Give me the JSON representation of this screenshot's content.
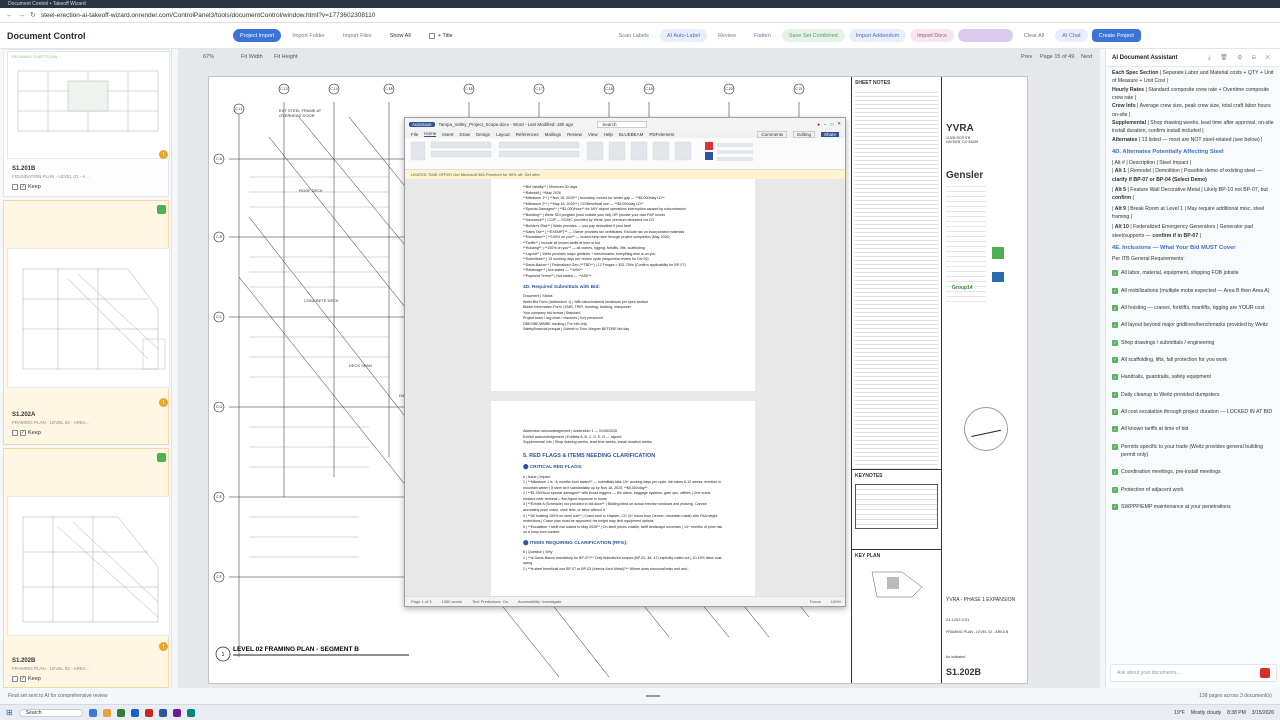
{
  "browser": {
    "tab_title": "Document Control • Takeoff Wizard",
    "url": "steel-erection-ai-takeoff-wizard.onrender.com/ControlPanel3/tools/documentControl/window.html?v=1773602308110"
  },
  "header": {
    "title": "Document Control",
    "buttons": [
      "Project Import",
      "Import Folder",
      "Import Files",
      "Show All",
      "+ Title",
      "Scan Labels",
      "AI Auto-Label",
      "Review",
      "Flatten",
      "Save Set Combined",
      "Import Addendum",
      "Import Docs",
      "",
      "Clear All",
      "AI Chat",
      "Create Project"
    ]
  },
  "sheets": [
    {
      "id": "S1.201B",
      "desc": "FOUNDATION PLAN - LEVEL 01 - A...",
      "keep": "Keep",
      "badge": "",
      "top_label": "RETAINED SHEETS (59)"
    },
    {
      "id": "S1.202A",
      "desc": "FRAMING PLAN - LEVEL 02 - AREA...",
      "keep": "Keep",
      "badge": "5"
    },
    {
      "id": "S1.202B",
      "desc": "FRAMING PLAN - LEVEL 02 - AREA...",
      "keep": "Keep",
      "badge": "5"
    }
  ],
  "viewer": {
    "zoom": "67%",
    "fit_width": "Fit Width",
    "fit_height": "Fit Height",
    "prev": "Prev",
    "page_info": "Page 15 of 49",
    "next": "Next",
    "plan_title": "LEVEL 02 FRAMING PLAN - SEGMENT B",
    "plan_number": "1",
    "grid_labels": [
      "C.11",
      "C.13",
      "C.14",
      "C.15",
      "C.16",
      "C.17",
      "C.18",
      "C.19",
      "C.20",
      "C.21",
      "C.A",
      "C.B",
      "C.C",
      "C.D",
      "C.E",
      "C.F"
    ]
  },
  "titleblock": {
    "sheet_notes": "SHEET NOTES",
    "keynotes": "KEYNOTES",
    "key_plan": "KEY PLAN",
    "client": "YVRA",
    "client_addr": "11305 RCR S'B\nHAYDEN, CO 81639",
    "architect": "Gensler",
    "group": "Group14",
    "project": "YVRA - PHASE 1 EXPANSION",
    "project_no": "24.1202.0.01",
    "sheet_title": "FRAMING PLAN - LEVEL 02 - AREA B",
    "sheet_no": "S1.202B",
    "scale": "As indicated"
  },
  "word": {
    "title": "Tampa_Valley_Project_Scope.docx  -  Word  -  Last Modified: 19h ago",
    "search": "Search",
    "menus": [
      "File",
      "Home",
      "Insert",
      "Draw",
      "Design",
      "Layout",
      "References",
      "Mailings",
      "Review",
      "View",
      "Help",
      "BLUEBEAM",
      "PDFelement"
    ],
    "comments": "Comments",
    "editing": "Editing",
    "share": "Share",
    "notice": "LIMITED TIME OFFER   Get Microsoft 365 Premium for 50% off.    Get offer",
    "page1_lines": [
      "**Bid Validity**  |  Minimum 30 days",
      "**Rate###  |  **May 2026",
      "**Milestone 1**  |  **Nov 18, 2025**  |  boundary, moved for winter gap — **$5,000/day LD**",
      "**Milestone 2**  |  **May 16, 2026**  |  CO/Beneficial use — **$3,000/day LD**",
      "**Special Damages**  |  **$1,000/hour** for ANY airport operations interruption caused by subcontractor",
      "**Bonding**  |  Weitz SDI program (cost outside your bid) OR provide your own P&P bonds",
      "**Insurance**  |  CCIP — SC/MC provided by Weitz; your premium deducted via CO",
      "**Builder's Risk**  |  Weitz provides — you pay deductible if your fault",
      "**Sales Tax**  |  **EXEMPT** — Owner provides tax certificates. Exclude tax on incorporated materials",
      "**Escalation**  |  **100% on you** — locked lump sum through project completion (May 2026)",
      "**Tariffs**  |  Include all known tariffs at time of bid",
      "**Hoisting**  |  **100% on you** — all cranes, rigging, forklifts, lifts, scaffolding",
      "**Layout**  |  Weitz provides major gridlines + benchmarks; everything else is on you",
      "**Submittals**  |  15 working days per review cycle (sequential review for Div 05)",
      "**Davis-Bacon**  |  Federalized Gen (**TBD**) | 12 Fringes = $31.75/hr (Confirm applicability for BP-07)",
      "**Retainage**  |  Not stated — **ASK**",
      "**Payment Terms**  |  Not stated — **ASK**"
    ],
    "section_4d": "4D. Required Submittals with Bid:",
    "page1_tail": [
      "Document  |  Status",
      "Weitz Bid Form (Addendum 1)  |  With labor/material breakouts per spec section",
      "Bidder Information Form  |  EMR, TRIR, bonding, backlog, manpower",
      "Your company bid format  |  Standard",
      "Project team / org chart / resumes  |  Key personnel",
      "DBE/SBE/WMBE tracking  |  For info only",
      "Safety/financial prequal  |  Submit to Trico Wegner BEFORE bid day"
    ],
    "page2_lines": [
      "Addendum acknowledgement  |  Addendum 1 — 01/06/2026",
      "Exhibit acknowledgement  |  Exhibits A, B, C, D, E, G — signed",
      "Supplemental info  |  Shop drawing weeks, lead time weeks, install duration weeks"
    ],
    "section_5": "5. RED FLAGS & ITEMS NEEDING CLARIFICATION",
    "critical": "CRITICAL RED FLAGS:",
    "critical_lines": [
      "#  |  Issue  |  Impact",
      "1  |  **Milestone 1 is ~6 months from award** — submittals take 15+ working days per cycle, fab takes 8-12 weeks; erection in mountain winter  |  If steel isn't substantially up by Nov 18, 2025, **$5,000/day**",
      "2  |  **$1,000/hour special damages** with broad triggers — fire alarm, baggage systems, gate ops, utilities  |  One crane incident near terminal = five-figure exposure in hours",
      "3  |  **Exhibit A (Schedule) not provided in bid docs**  |  Bidding blind on actual erection windows and phasing. Cannot accurately price crane, crew time, or labor without it",
      "4  |  **All hoisting 100% on steel sub**  |  Crane stub to Hayden, CO (4+ hours from Denver, mountain roads) with FAA height restrictions  |  Crane plan must be approved; his height may limit equipment options",
      "5  |  **Escalation + tariff risk locked to May 2026**  |  On steel prices volatile, tariff landscape uncertain  |  14+ months of price risk on a lump sum number"
    ],
    "rfi_head": "ITEMS REQUIRING CLARIFICATION (RFIs):",
    "rfi_lines": [
      "#  |  Question  |  Why",
      "1  |  **Is Davis-Bacon mandatory for BP-07?**  Only federalized scopes (BP-02, 46, 47) explicitly called out  |  10-15% labor cost swing",
      "2  |  **Is steel beneficial use BP-07 or BP-03 (Interior Arch Metal)?**  Where does structural/misc end and..."
    ],
    "status": [
      "Page 1 of 3",
      "1350 words",
      "Text Predictions: On",
      "Accessibility: Investigate",
      "Focus",
      "100%"
    ]
  },
  "assistant": {
    "title": "AI Document Assistant",
    "intro_lines": [
      {
        "b": "Each Spec Section",
        "t": " | Separate Labor and Material costs + QTY + Unit of Measure + Unit Cost |"
      },
      {
        "b": "Hourly Rates",
        "t": " | Standard composite crew rate + Overtime composite crew rate |"
      },
      {
        "b": "Crew Info",
        "t": " | Average crew size, peak crew size, total craft labor hours on-site |"
      },
      {
        "b": "Supplemental",
        "t": " | Shop drawing weeks, lead time after approval, on-site install duration, confirm install included |"
      },
      {
        "b": "Alternates",
        "t": " | 13 listed — most are NOT steel-related (see below) |"
      }
    ],
    "h_4d": "4D. Alternates Potentially Affecting Steel",
    "alt_head": "| Alt # | Description | Steel Impact |",
    "alts": [
      {
        "b": "Alt 1",
        "t": " | Remodel | Demolition | Possible demo of existing steel — ",
        "b2": "clarify if BP-07 or BP-04 (Select Demo)",
        "t2": ""
      },
      {
        "b": "Alt 5",
        "t": " | Feature Wall Decorative Metal | Likely BP-10 not BP-07, but ",
        "b2": "confirm",
        "t2": " |"
      },
      {
        "b": "Alt 9",
        "t": " | Break Room at Level 1 | May require additional misc. steel framing |",
        "b2": "",
        "t2": ""
      },
      {
        "b": "Alt 10",
        "t": " | Federalized Emergency Generators | Generator pad steel/supports — ",
        "b2": "confirm if in BP-07",
        "t2": " |"
      }
    ],
    "h_4e": "4E. Inclusions — What Your Bid MUST Cover",
    "itb": "Per ITB General Requirements:",
    "inclusions": [
      "All labor, material, equipment, shipping FOB jobsite",
      "All mobilizations (multiple mobs expected — Area B then Area A)",
      "All hoisting — cranes, forklifts, manlifts, rigging are YOUR cost",
      "All layout beyond major gridlines/benchmarks provided by Weitz",
      "Shop drawings / submittals / engineering",
      "All scaffolding, lifts, fall protection for you work",
      "Handrails, guardrails, safety equipment",
      "Daily cleanup to Weitz-provided dumpsters",
      "All cost escalation through project duration — LOCKED IN AT BID",
      "All known tariffs at time of bid",
      "Permits specific to your trade (Weitz provides general building permit only)",
      "Coordination meetings, pre-install meetings",
      "Protection of adjacent work",
      "SWPPP/EMP maintenance at your penetrations"
    ],
    "input_placeholder": "Ask about your documents..."
  },
  "status": {
    "left": "Final set sent to AI for comprehensive review",
    "right": "138 pages across 3 document(s)"
  },
  "taskbar": {
    "search": "Search",
    "weather": "19°F",
    "weather_desc": "Mostly cloudy",
    "time": "8:38 PM",
    "date": "3/15/2026"
  },
  "colors": {
    "accent": "#3b73d6",
    "success": "#4caf50",
    "warning": "#e9a72b",
    "assistant_heading": "#3a6fc8",
    "word_heading": "#2f5496"
  }
}
